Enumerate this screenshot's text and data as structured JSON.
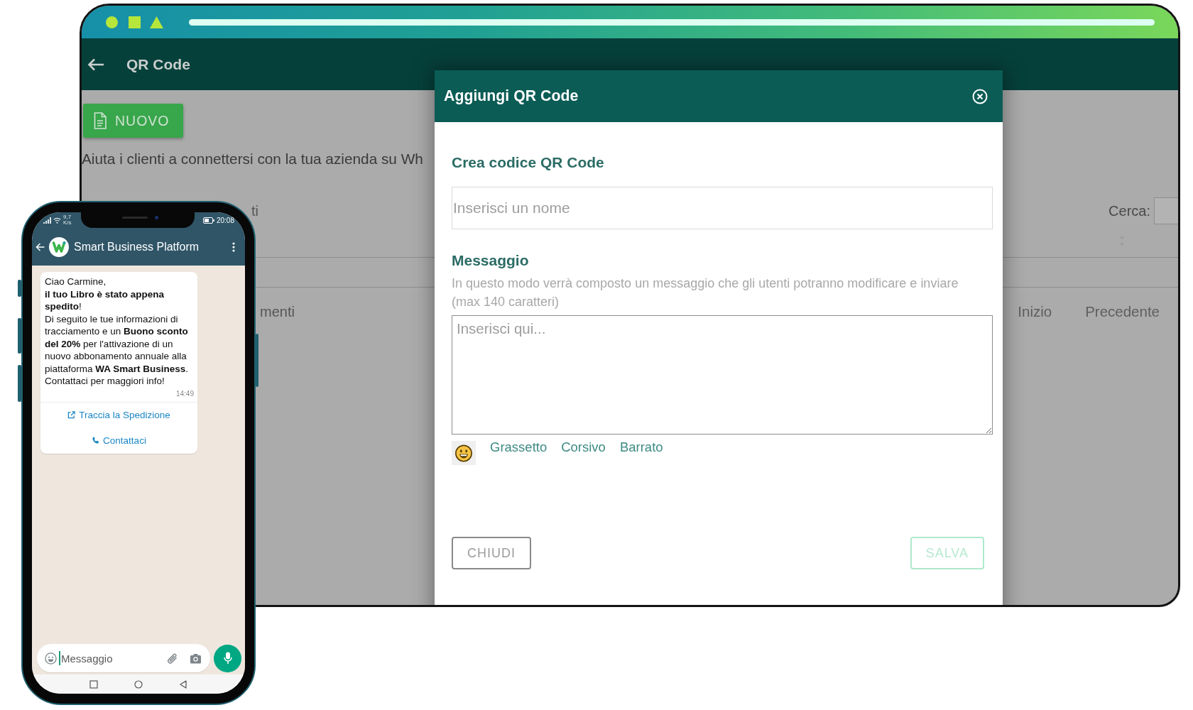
{
  "tablet": {
    "header": {
      "title": "QR Code"
    },
    "new_button": {
      "label": "NUOVO"
    },
    "description": "Aiuta i clienti a connettersi con la tua azienda su Wh",
    "table": {
      "length_fragment": "ti",
      "search_label": "Cerca:",
      "info_fragment": "menti",
      "pagination": [
        "Inizio",
        "Precedente"
      ]
    }
  },
  "modal": {
    "title": "Aggiungi QR Code",
    "name_heading": "Crea codice QR Code",
    "name_field": {
      "placeholder": "Inserisci un nome"
    },
    "message_heading": "Messaggio",
    "message_hint": "In questo modo verrà composto un messaggio che gli utenti potranno modificare e inviare (max 140 caratteri)",
    "message_field": {
      "placeholder": "Inserisci qui..."
    },
    "format_links": [
      "Grassetto",
      "Corsivo",
      "Barrato"
    ],
    "buttons": [
      {
        "label": "CHIUDI",
        "disabled": false
      },
      {
        "label": "SALVA",
        "disabled": true
      }
    ]
  },
  "phone": {
    "status_bar": {
      "speed_value": "9,7",
      "speed_unit": "K/s",
      "time": "20:08"
    },
    "chat": {
      "contact": "Smart Business Platform",
      "message": {
        "paragraphs": [
          "Ciao Carmine,",
          "**il tuo Libro è stato appena spedito**!",
          "Di seguito le tue informazioni di tracciamento e un **Buono sconto del 20%** per l'attivazione di un nuovo abbonamento annuale alla piattaforma **WA Smart Business**.",
          "Contattaci per maggiori info!"
        ],
        "time": "14:49",
        "actions": [
          {
            "label": "Traccia la Spedizione",
            "kind": "link"
          },
          {
            "label": "Contattaci",
            "kind": "call"
          }
        ]
      },
      "composer": {
        "placeholder": "Messaggio"
      }
    }
  }
}
